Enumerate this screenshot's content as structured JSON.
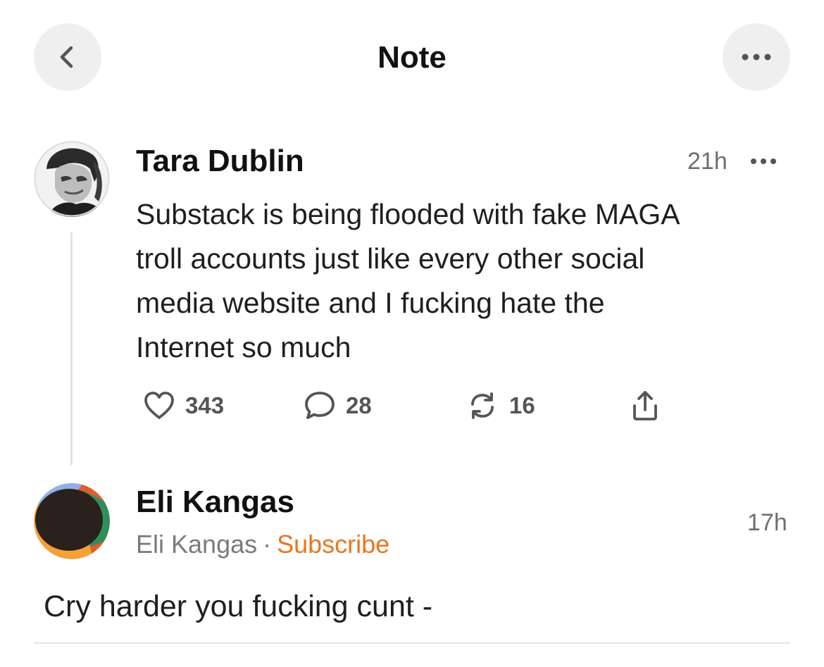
{
  "header": {
    "title": "Note",
    "back_icon": "chevron-left-icon",
    "more_icon": "ellipsis-icon"
  },
  "note": {
    "author": "Tara Dublin",
    "time": "21h",
    "body_lines": [
      "Substack is being flooded with fake MAGA",
      "troll accounts just like every other social",
      "media website and I fucking hate the",
      "Internet so much"
    ],
    "likes": "343",
    "comments": "28",
    "restacks": "16",
    "icons": {
      "like": "heart-icon",
      "comment": "comment-bubble-icon",
      "restack": "restack-arrows-icon",
      "share": "share-icon"
    }
  },
  "reply": {
    "author": "Eli Kangas",
    "byline_name": "Eli Kangas",
    "byline_separator": "·",
    "subscribe_label": "Subscribe",
    "time": "17h",
    "body": "Cry harder you fucking cunt -"
  },
  "colors": {
    "accent_subscribe": "#e8761f",
    "button_background": "#efefef",
    "secondary_text": "#6f6f6f"
  }
}
